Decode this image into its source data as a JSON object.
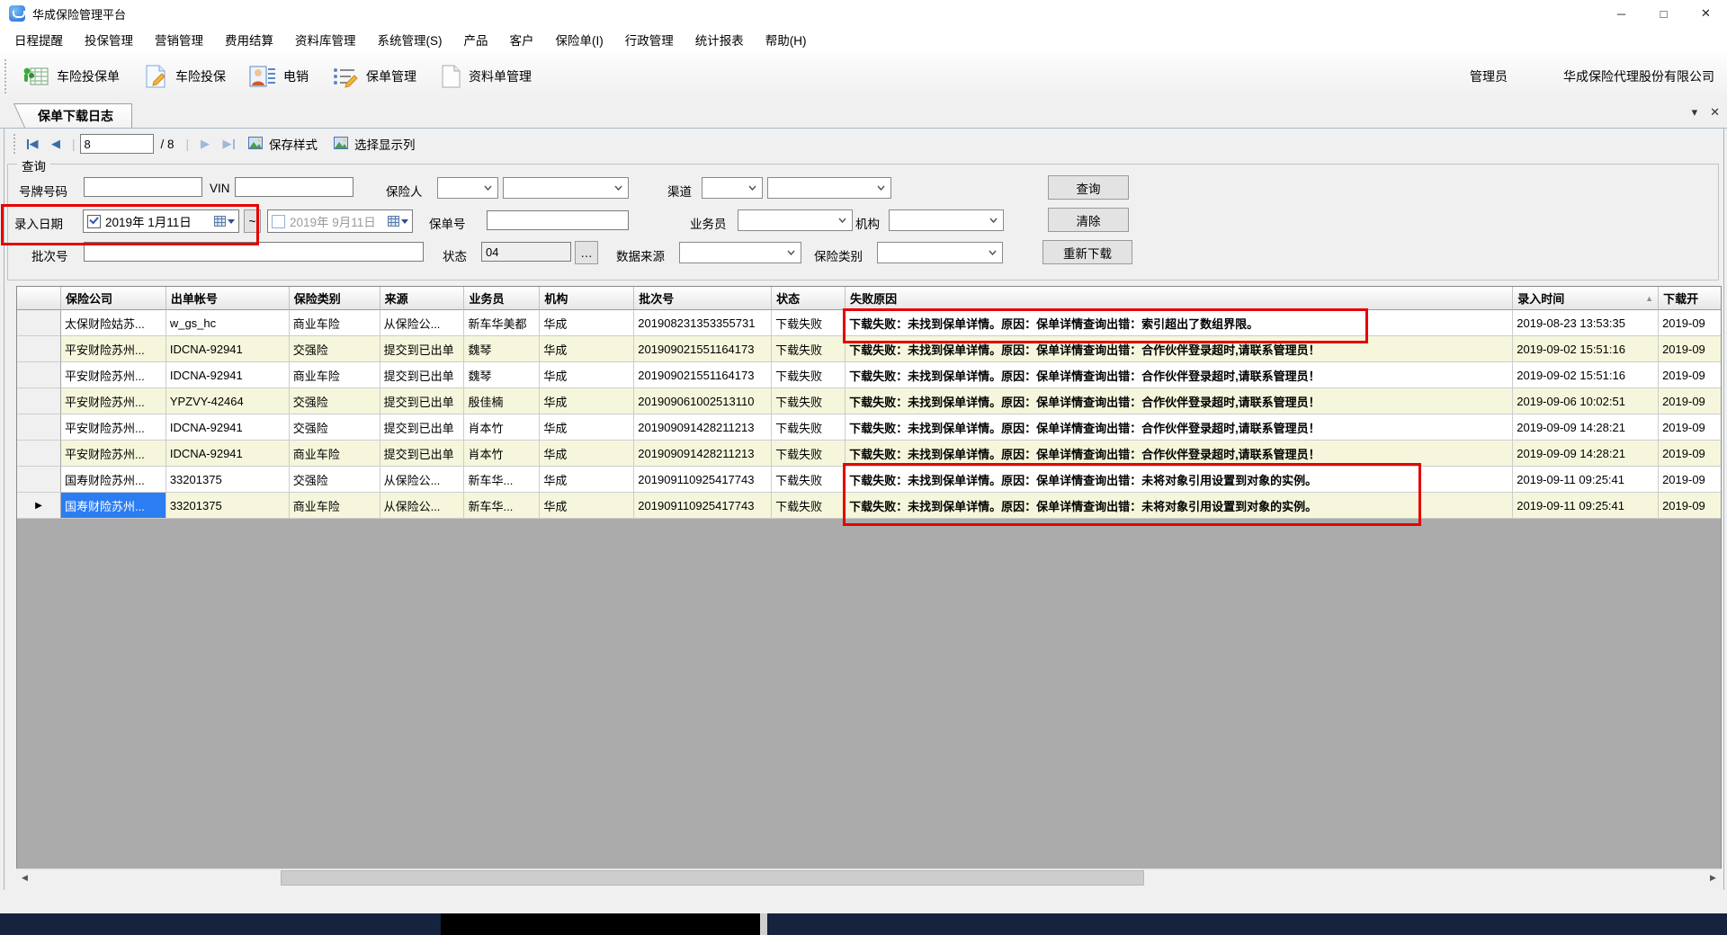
{
  "window": {
    "title": "华成保险管理平台",
    "minimize": "─",
    "maximize": "□",
    "close": "✕"
  },
  "menu": {
    "items": [
      "日程提醒",
      "投保管理",
      "营销管理",
      "费用结算",
      "资料库管理",
      "系统管理(S)",
      "产品",
      "客户",
      "保险单(I)",
      "行政管理",
      "统计报表",
      "帮助(H)"
    ]
  },
  "toolbar": {
    "items": [
      {
        "label": "车险投保单"
      },
      {
        "label": "车险投保"
      },
      {
        "label": "电销"
      },
      {
        "label": "保单管理"
      },
      {
        "label": "资料单管理"
      }
    ],
    "user": "管理员",
    "company": "华成保险代理股份有限公司"
  },
  "tabs": {
    "active": "保单下载日志",
    "dropdown_glyph": "▾",
    "close_glyph": "✕"
  },
  "pager": {
    "page": "8",
    "total": "/ 8",
    "save_style": "保存样式",
    "select_columns": "选择显示列"
  },
  "query": {
    "legend": "查询",
    "plate_label": "号牌号码",
    "plate_value": "",
    "vin_label": "VIN",
    "vin_value": "",
    "insurer_label": "保险人",
    "channel_label": "渠道",
    "entry_date_label": "录入日期",
    "date_from": "2019年 1月11日",
    "range_separator": "~",
    "date_to": "2019年 9月11日",
    "policy_label": "保单号",
    "policy_value": "",
    "agent_label": "业务员",
    "org_label": "机构",
    "batch_label": "批次号",
    "batch_value": "",
    "status_label": "状态",
    "status_value": "04",
    "status_more": "…",
    "source_label": "数据来源",
    "category_label": "保险类别",
    "query_btn": "查询",
    "clear_btn": "清除",
    "redownload_btn": "重新下载"
  },
  "table": {
    "columns": [
      "",
      "保险公司",
      "出单帐号",
      "保险类别",
      "来源",
      "业务员",
      "机构",
      "批次号",
      "状态",
      "失败原因",
      "录入时间",
      "下载开"
    ],
    "sort_indicator": "▲",
    "current_row_marker": "▶",
    "rows": [
      {
        "company": "太保财险姑苏...",
        "account": "w_gs_hc",
        "category": "商业车险",
        "source": "从保险公...",
        "agent": "新车华美都",
        "org": "华成",
        "batch": "201908231353355731",
        "status": "下载失败",
        "reason": "下载失败：未找到保单详情。原因：保单详情查询出错：索引超出了数组界限。",
        "entry_time": "2019-08-23 13:53:35",
        "download_time": "2019-09"
      },
      {
        "company": "平安财险苏州...",
        "account": "IDCNA-92941",
        "category": "交强险",
        "source": "提交到已出单",
        "agent": "魏琴",
        "org": "华成",
        "batch": "201909021551164173",
        "status": "下载失败",
        "reason": "下载失败：未找到保单详情。原因：保单详情查询出错：合作伙伴登录超时,请联系管理员！",
        "entry_time": "2019-09-02 15:51:16",
        "download_time": "2019-09"
      },
      {
        "company": "平安财险苏州...",
        "account": "IDCNA-92941",
        "category": "商业车险",
        "source": "提交到已出单",
        "agent": "魏琴",
        "org": "华成",
        "batch": "201909021551164173",
        "status": "下载失败",
        "reason": "下载失败：未找到保单详情。原因：保单详情查询出错：合作伙伴登录超时,请联系管理员！",
        "entry_time": "2019-09-02 15:51:16",
        "download_time": "2019-09"
      },
      {
        "company": "平安财险苏州...",
        "account": "YPZVY-42464",
        "category": "交强险",
        "source": "提交到已出单",
        "agent": "殷佳楠",
        "org": "华成",
        "batch": "201909061002513110",
        "status": "下载失败",
        "reason": "下载失败：未找到保单详情。原因：保单详情查询出错：合作伙伴登录超时,请联系管理员！",
        "entry_time": "2019-09-06 10:02:51",
        "download_time": "2019-09"
      },
      {
        "company": "平安财险苏州...",
        "account": "IDCNA-92941",
        "category": "交强险",
        "source": "提交到已出单",
        "agent": "肖本竹",
        "org": "华成",
        "batch": "201909091428211213",
        "status": "下载失败",
        "reason": "下载失败：未找到保单详情。原因：保单详情查询出错：合作伙伴登录超时,请联系管理员！",
        "entry_time": "2019-09-09 14:28:21",
        "download_time": "2019-09"
      },
      {
        "company": "平安财险苏州...",
        "account": "IDCNA-92941",
        "category": "商业车险",
        "source": "提交到已出单",
        "agent": "肖本竹",
        "org": "华成",
        "batch": "201909091428211213",
        "status": "下载失败",
        "reason": "下载失败：未找到保单详情。原因：保单详情查询出错：合作伙伴登录超时,请联系管理员！",
        "entry_time": "2019-09-09 14:28:21",
        "download_time": "2019-09"
      },
      {
        "company": "国寿财险苏州...",
        "account": "33201375",
        "category": "交强险",
        "source": "从保险公...",
        "agent": "新车华...",
        "org": "华成",
        "batch": "201909110925417743",
        "status": "下载失败",
        "reason": "下载失败：未找到保单详情。原因：保单详情查询出错：未将对象引用设置到对象的实例。",
        "entry_time": "2019-09-11 09:25:41",
        "download_time": "2019-09"
      },
      {
        "company": "国寿财险苏州...",
        "account": "33201375",
        "category": "商业车险",
        "source": "从保险公...",
        "agent": "新车华...",
        "org": "华成",
        "batch": "201909110925417743",
        "status": "下载失败",
        "reason": "下载失败：未找到保单详情。原因：保单详情查询出错：未将对象引用设置到对象的实例。",
        "entry_time": "2019-09-11 09:25:41",
        "download_time": "2019-09",
        "selected": true,
        "current": true
      }
    ]
  }
}
